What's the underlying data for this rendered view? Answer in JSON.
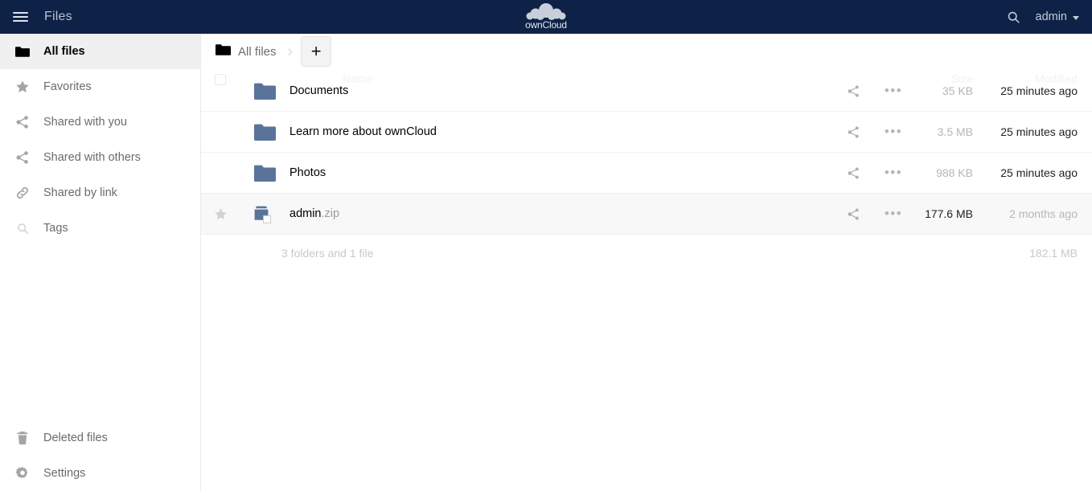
{
  "header": {
    "menu_icon": "hamburger-icon",
    "app_title": "Files",
    "logo_text": "ownCloud",
    "search_icon": "search-icon",
    "user_name": "admin",
    "bg_color": "#0e2247"
  },
  "sidebar": {
    "items": [
      {
        "label": "All files",
        "icon": "folder-icon",
        "active": true
      },
      {
        "label": "Favorites",
        "icon": "star-icon",
        "active": false
      },
      {
        "label": "Shared with you",
        "icon": "share-icon",
        "active": false
      },
      {
        "label": "Shared with others",
        "icon": "share-icon",
        "active": false
      },
      {
        "label": "Shared by link",
        "icon": "link-icon",
        "active": false
      },
      {
        "label": "Tags",
        "icon": "magnifier-icon",
        "active": false
      }
    ],
    "bottom_items": [
      {
        "label": "Deleted files",
        "icon": "trash-icon"
      },
      {
        "label": "Settings",
        "icon": "gear-icon"
      }
    ]
  },
  "breadcrumb": {
    "root_label": "All files",
    "root_icon": "folder-icon",
    "separator": "›",
    "new_button_label": "+"
  },
  "table": {
    "headers": {
      "name": "Name",
      "size": "Size",
      "modified": "Modified"
    },
    "rows": [
      {
        "name": "Documents",
        "ext": "",
        "icon": "folder-icon",
        "size": "35 KB",
        "modified": "25 minutes ago",
        "favorite": false,
        "selected": false,
        "size_emphasis": "light",
        "modified_emphasis": "dark"
      },
      {
        "name": "Learn more about ownCloud",
        "ext": "",
        "icon": "folder-icon",
        "size": "3.5 MB",
        "modified": "25 minutes ago",
        "favorite": false,
        "selected": false,
        "size_emphasis": "light",
        "modified_emphasis": "dark"
      },
      {
        "name": "Photos",
        "ext": "",
        "icon": "folder-icon",
        "size": "988 KB",
        "modified": "25 minutes ago",
        "favorite": false,
        "selected": false,
        "size_emphasis": "light",
        "modified_emphasis": "dark"
      },
      {
        "name": "admin",
        "ext": ".zip",
        "icon": "package-icon",
        "size": "177.6 MB",
        "modified": "2 months ago",
        "favorite": true,
        "selected": true,
        "size_emphasis": "dark",
        "modified_emphasis": "light"
      }
    ],
    "share_icon": "share-icon",
    "more_icon": "ellipsis-icon",
    "more_glyph": "•••"
  },
  "summary": {
    "count_text": "3 folders and 1 file",
    "total_size": "182.1 MB"
  },
  "colors": {
    "header_bg": "#0e2247",
    "folder_icon": "#5a7499",
    "selected_row": "#f8f8f8",
    "active_nav": "#f0f0f0"
  }
}
